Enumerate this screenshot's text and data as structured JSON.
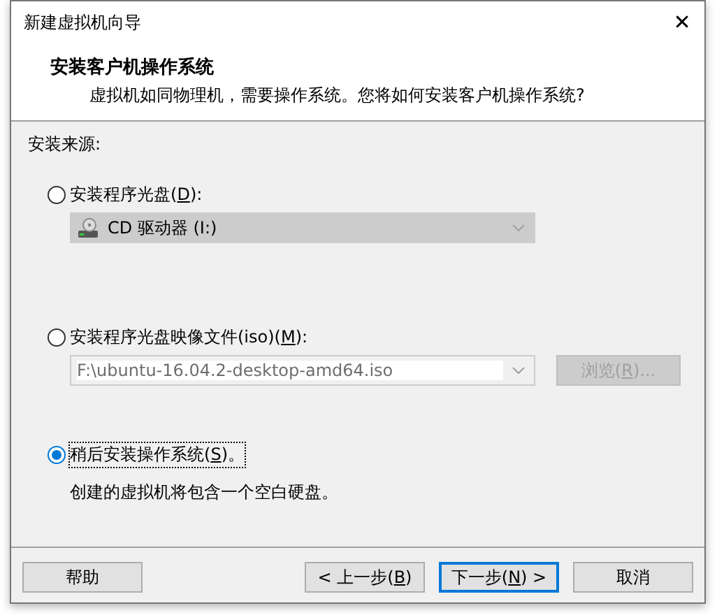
{
  "window": {
    "title": "新建虚拟机向导",
    "close": "✕"
  },
  "header": {
    "title": "安装客户机操作系统",
    "subtitle": "虚拟机如同物理机，需要操作系统。您将如何安装客户机操作系统?"
  },
  "source_label": "安装来源:",
  "options": [
    {
      "kind": "drive",
      "label_before": "安装程序光盘(",
      "mnemonic": "D",
      "label_after": "):",
      "selected": false,
      "combo": {
        "value": "CD 驱动器 (I:)",
        "disabled": true
      }
    },
    {
      "kind": "iso",
      "label_before": "安装程序光盘映像文件(iso)(",
      "mnemonic": "M",
      "label_after": "):",
      "selected": false,
      "combo": {
        "value": "F:\\ubuntu-16.04.2-desktop-amd64.iso",
        "disabled": true
      },
      "browse": {
        "label_before": "浏览(",
        "mnemonic": "R",
        "label_after": ")...",
        "disabled": true
      }
    },
    {
      "kind": "later",
      "label_before": "稍后安装操作系统(",
      "mnemonic": "S",
      "label_after": ")。",
      "selected": true,
      "description": "创建的虚拟机将包含一个空白硬盘。"
    }
  ],
  "buttons": [
    {
      "kind": "help",
      "label_before": "帮助",
      "default": false
    },
    {
      "kind": "back",
      "label_before": "< 上一步(",
      "mnemonic": "B",
      "label_after": ")",
      "default": false
    },
    {
      "kind": "next",
      "label_before": "下一步(",
      "mnemonic": "N",
      "label_after": ") >",
      "default": true
    },
    {
      "kind": "cancel",
      "label_before": "取消",
      "default": false
    }
  ]
}
